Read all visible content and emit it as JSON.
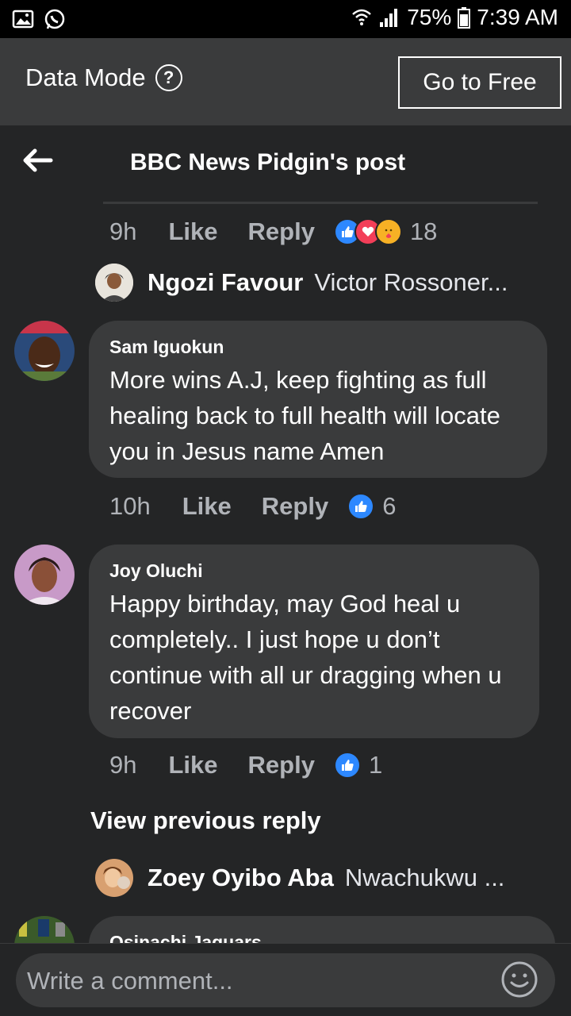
{
  "status_bar": {
    "battery": "75%",
    "time": "7:39 AM"
  },
  "data_mode": {
    "label": "Data Mode",
    "help": "?",
    "button": "Go to Free"
  },
  "header": {
    "title": "BBC News Pidgin's post"
  },
  "colors": {
    "like_blue": "#2d88ff",
    "love_red": "#f33e58",
    "care_yellow": "#f7b125",
    "bubble": "#3a3b3c",
    "surface": "#242526"
  },
  "comments": [
    {
      "time": "9h",
      "like": "Like",
      "reply": "Reply",
      "reactions": [
        "like-icon",
        "love-icon",
        "care-icon"
      ],
      "reaction_count": "18",
      "reply_preview": {
        "name": "Ngozi Favour",
        "snippet": "Victor Rossoner..."
      }
    },
    {
      "author": "Sam Iguokun",
      "text": "More wins A.J, keep fighting as full healing back to full health will locate you in Jesus name Amen",
      "time": "10h",
      "like": "Like",
      "reply": "Reply",
      "reactions": [
        "like-icon"
      ],
      "reaction_count": "6"
    },
    {
      "author": "Joy Oluchi",
      "text": "Happy birthday, may God heal u completely.. I just hope u don’t continue with all ur dragging when u recover",
      "time": "9h",
      "like": "Like",
      "reply": "Reply",
      "reactions": [
        "like-icon"
      ],
      "reaction_count": "1",
      "view_previous": "View previous reply",
      "reply_preview": {
        "name": "Zoey Oyibo Aba",
        "snippet": "Nwachukwu ..."
      }
    },
    {
      "author": "Osinachi Jaguars"
    }
  ],
  "composer": {
    "placeholder": "Write a comment..."
  }
}
